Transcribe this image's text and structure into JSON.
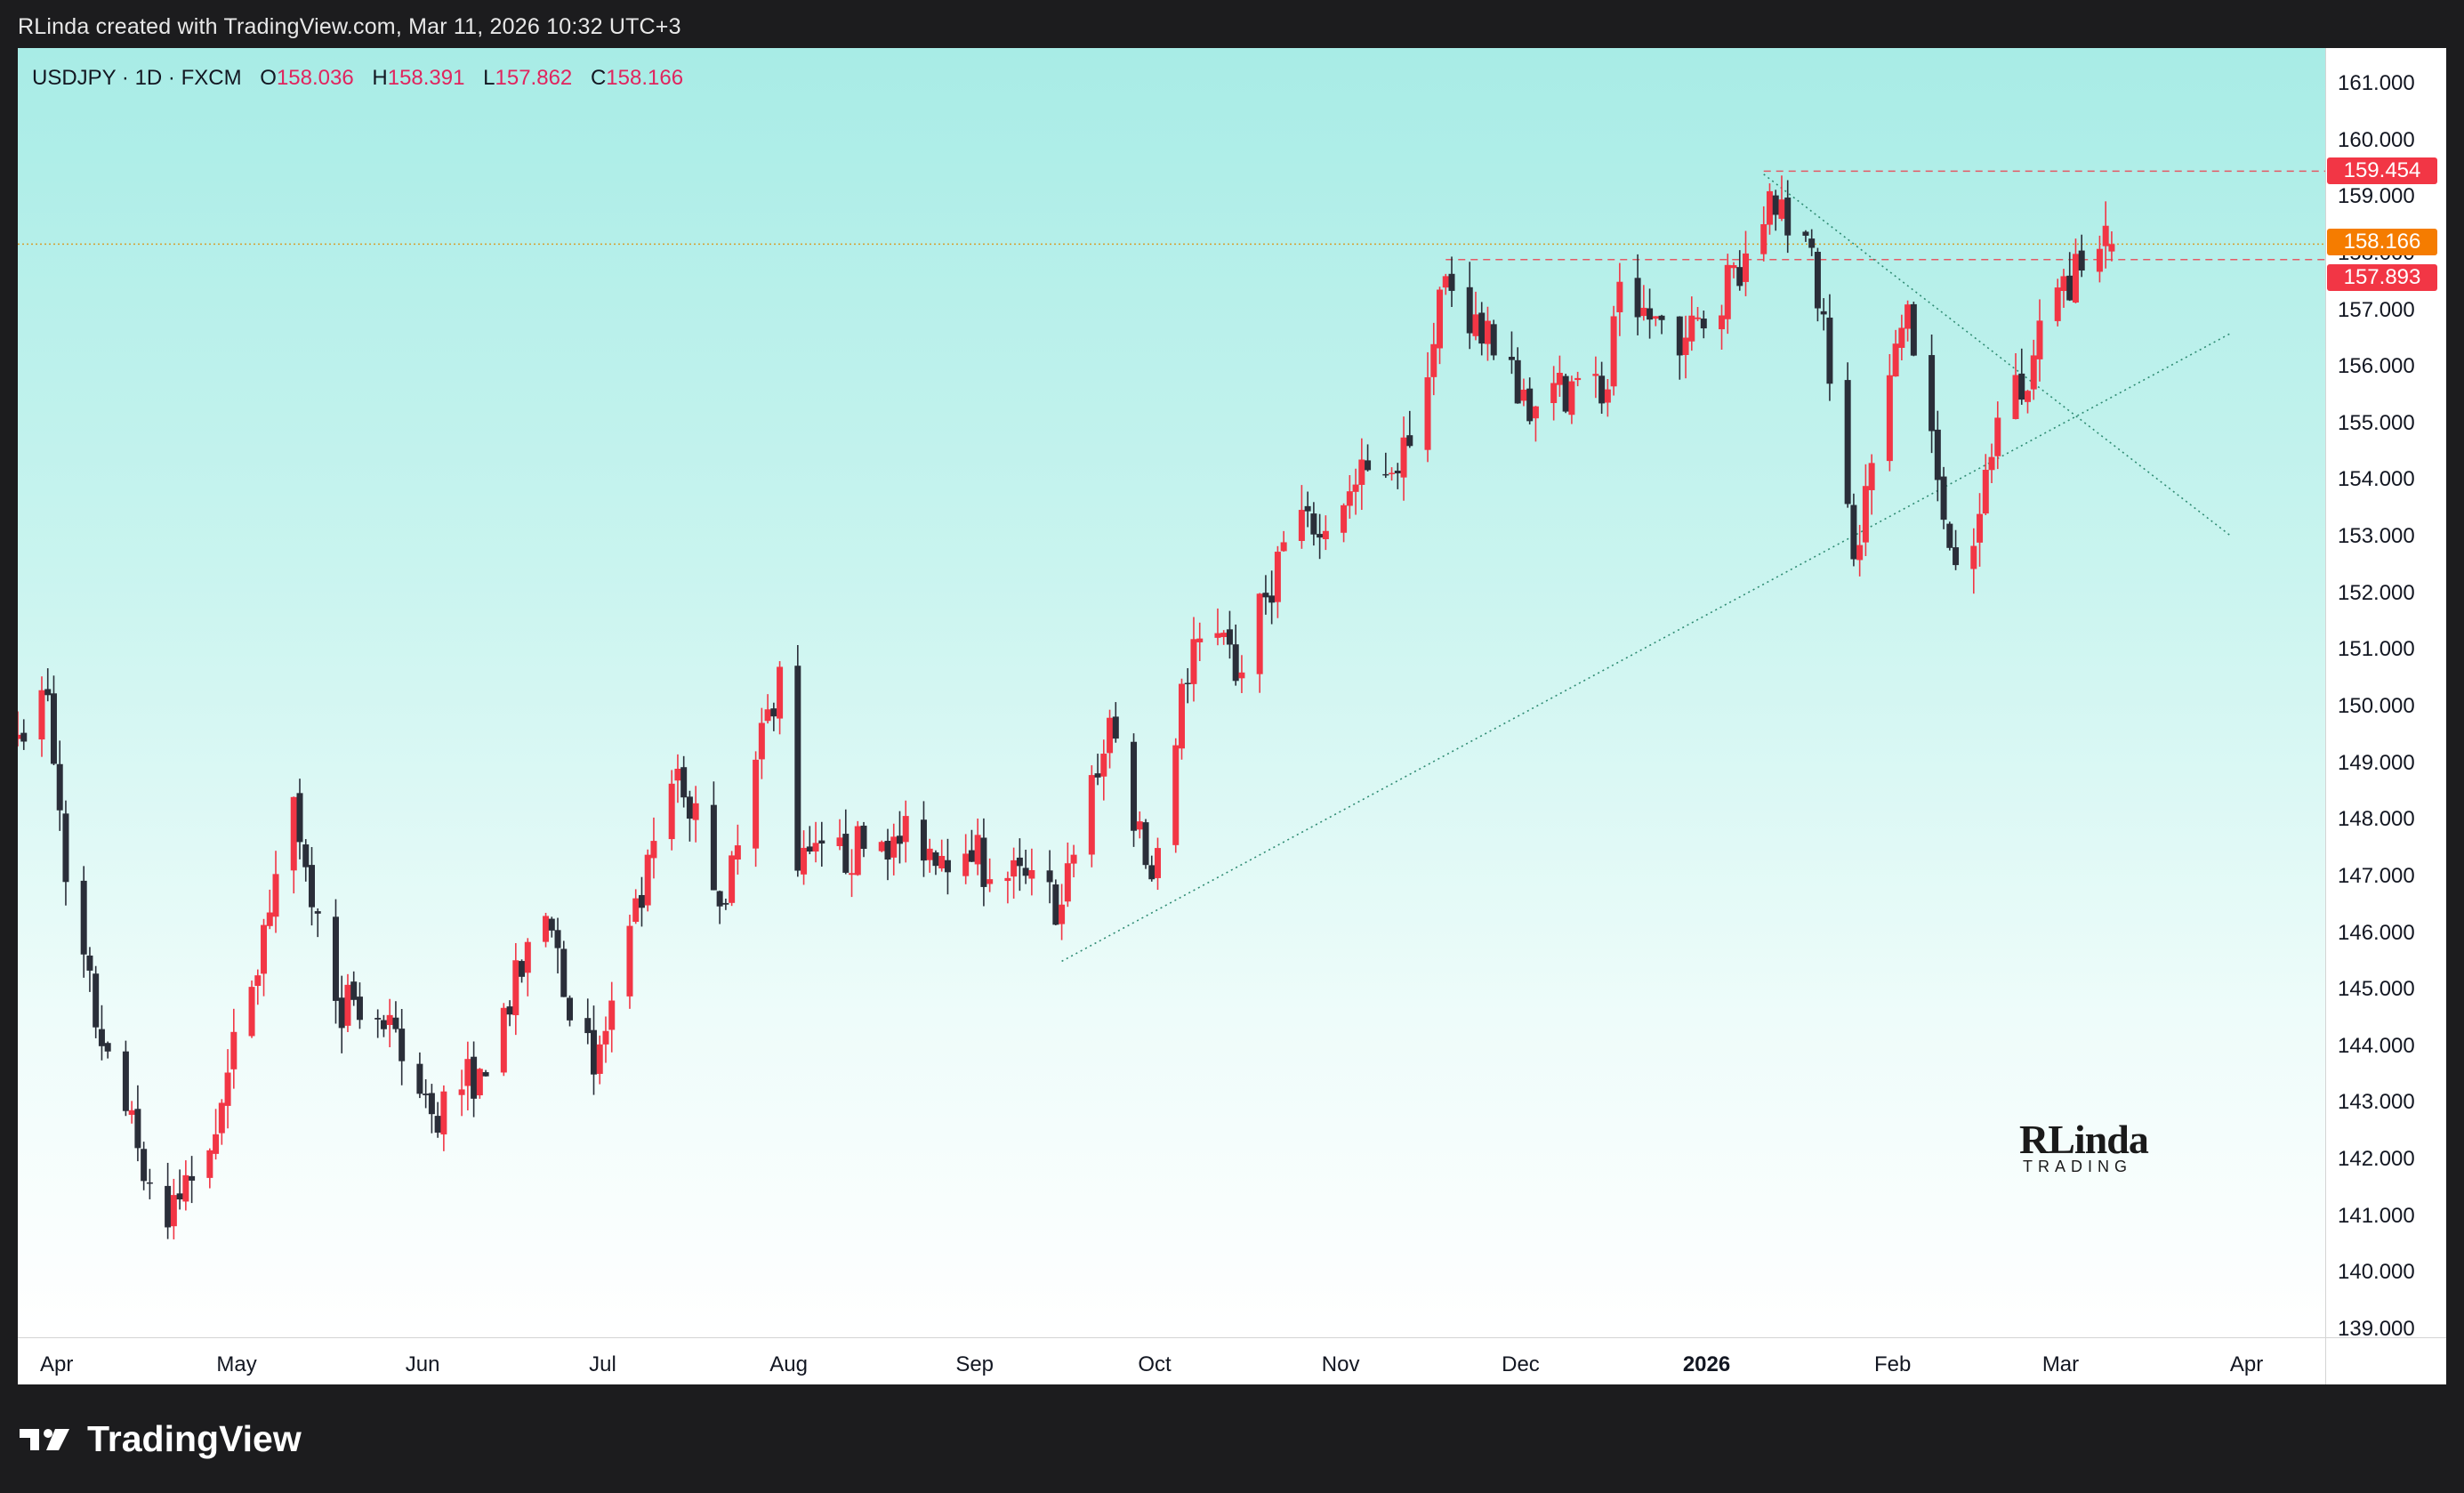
{
  "header": {
    "text": "RLinda created with TradingView.com, Mar 11, 2026 10:32 UTC+3"
  },
  "legend": {
    "symbol": "USDJPY · 1D · FXCM",
    "open_label": "O",
    "open": "158.036",
    "high_label": "H",
    "high": "158.391",
    "low_label": "L",
    "low": "157.862",
    "close_label": "C",
    "close": "158.166"
  },
  "price_tags": {
    "resistance_high": "159.454",
    "current": "158.166",
    "resistance_low": "157.893"
  },
  "y_axis_labels": [
    "161.000",
    "160.000",
    "159.000",
    "158.000",
    "157.000",
    "156.000",
    "155.000",
    "154.000",
    "153.000",
    "152.000",
    "151.000",
    "150.000",
    "149.000",
    "148.000",
    "147.000",
    "146.000",
    "145.000",
    "144.000",
    "143.000",
    "142.000",
    "141.000",
    "140.000",
    "139.000"
  ],
  "x_axis_labels": [
    {
      "text": "Apr",
      "bold": false
    },
    {
      "text": "May",
      "bold": false
    },
    {
      "text": "Jun",
      "bold": false
    },
    {
      "text": "Jul",
      "bold": false
    },
    {
      "text": "Aug",
      "bold": false
    },
    {
      "text": "Sep",
      "bold": false
    },
    {
      "text": "Oct",
      "bold": false
    },
    {
      "text": "Nov",
      "bold": false
    },
    {
      "text": "Dec",
      "bold": false
    },
    {
      "text": "2026",
      "bold": true
    },
    {
      "text": "Feb",
      "bold": false
    },
    {
      "text": "Mar",
      "bold": false
    },
    {
      "text": "Apr",
      "bold": false
    }
  ],
  "watermark": {
    "line1": "RLinda",
    "line2": "TRADING"
  },
  "footer": {
    "brand": "TradingView"
  },
  "colors": {
    "up": "#f23645",
    "down": "#2a2e39",
    "current_tag": "#f57c00",
    "res_tag": "#f23645"
  },
  "chart_data": {
    "type": "candlestick",
    "symbol": "USDJPY",
    "timeframe": "1D",
    "ylim": [
      139,
      161
    ],
    "x_range": [
      "2025-03-27",
      "2026-04-15"
    ],
    "levels": [
      159.454,
      158.166,
      157.893
    ],
    "trendline_support": {
      "from": [
        "2025-09-17",
        145.5
      ],
      "to": [
        "2026-03-31",
        156.6
      ]
    },
    "trendline_descending": {
      "from": [
        "2026-01-12",
        159.4
      ],
      "to": [
        "2026-03-31",
        153.0
      ]
    },
    "keypoints": [
      {
        "date": "2025-03-27",
        "close": 149.5
      },
      {
        "date": "2025-04-01",
        "close": 150.2
      },
      {
        "date": "2025-04-04",
        "close": 146.9
      },
      {
        "date": "2025-04-10",
        "close": 144.0
      },
      {
        "date": "2025-04-16",
        "close": 142.2
      },
      {
        "date": "2025-04-21",
        "close": 140.8
      },
      {
        "date": "2025-04-30",
        "close": 143.0
      },
      {
        "date": "2025-05-12",
        "close": 148.4
      },
      {
        "date": "2025-05-19",
        "close": 144.8
      },
      {
        "date": "2025-05-27",
        "close": 144.3
      },
      {
        "date": "2025-06-04",
        "close": 142.8
      },
      {
        "date": "2025-06-12",
        "close": 143.6
      },
      {
        "date": "2025-06-23",
        "close": 146.3
      },
      {
        "date": "2025-07-01",
        "close": 143.5
      },
      {
        "date": "2025-07-15",
        "close": 148.9
      },
      {
        "date": "2025-07-23",
        "close": 146.5
      },
      {
        "date": "2025-08-01",
        "close": 150.7
      },
      {
        "date": "2025-08-04",
        "close": 147.1
      },
      {
        "date": "2025-08-20",
        "close": 147.7
      },
      {
        "date": "2025-09-01",
        "close": 147.4
      },
      {
        "date": "2025-09-17",
        "close": 146.5
      },
      {
        "date": "2025-09-25",
        "close": 149.8
      },
      {
        "date": "2025-10-01",
        "close": 147.2
      },
      {
        "date": "2025-10-03",
        "close": 147.5
      },
      {
        "date": "2025-10-07",
        "close": 150.4
      },
      {
        "date": "2025-10-10",
        "close": 151.2
      },
      {
        "date": "2025-10-17",
        "close": 150.6
      },
      {
        "date": "2025-10-24",
        "close": 152.9
      },
      {
        "date": "2025-11-04",
        "close": 153.8
      },
      {
        "date": "2025-11-14",
        "close": 154.6
      },
      {
        "date": "2025-11-20",
        "close": 157.6
      },
      {
        "date": "2025-11-28",
        "close": 156.2
      },
      {
        "date": "2025-12-05",
        "close": 155.3
      },
      {
        "date": "2025-12-12",
        "close": 155.8
      },
      {
        "date": "2025-12-17",
        "close": 155.6
      },
      {
        "date": "2025-12-19",
        "close": 157.5
      },
      {
        "date": "2025-12-29",
        "close": 156.2
      },
      {
        "date": "2026-01-09",
        "close": 158.0
      },
      {
        "date": "2026-01-13",
        "close": 159.1
      },
      {
        "date": "2026-01-20",
        "close": 158.1
      },
      {
        "date": "2026-01-23",
        "close": 155.7
      },
      {
        "date": "2026-01-27",
        "close": 152.6
      },
      {
        "date": "2026-01-30",
        "close": 154.3
      },
      {
        "date": "2026-02-05",
        "close": 157.1
      },
      {
        "date": "2026-02-10",
        "close": 154.0
      },
      {
        "date": "2026-02-12",
        "close": 152.8
      },
      {
        "date": "2026-02-17",
        "close": 153.4
      },
      {
        "date": "2026-02-20",
        "close": 155.1
      },
      {
        "date": "2026-02-26",
        "close": 156.2
      },
      {
        "date": "2026-03-02",
        "close": 157.4
      },
      {
        "date": "2026-03-06",
        "close": 157.7
      },
      {
        "date": "2026-03-11",
        "close": 158.166
      }
    ]
  }
}
